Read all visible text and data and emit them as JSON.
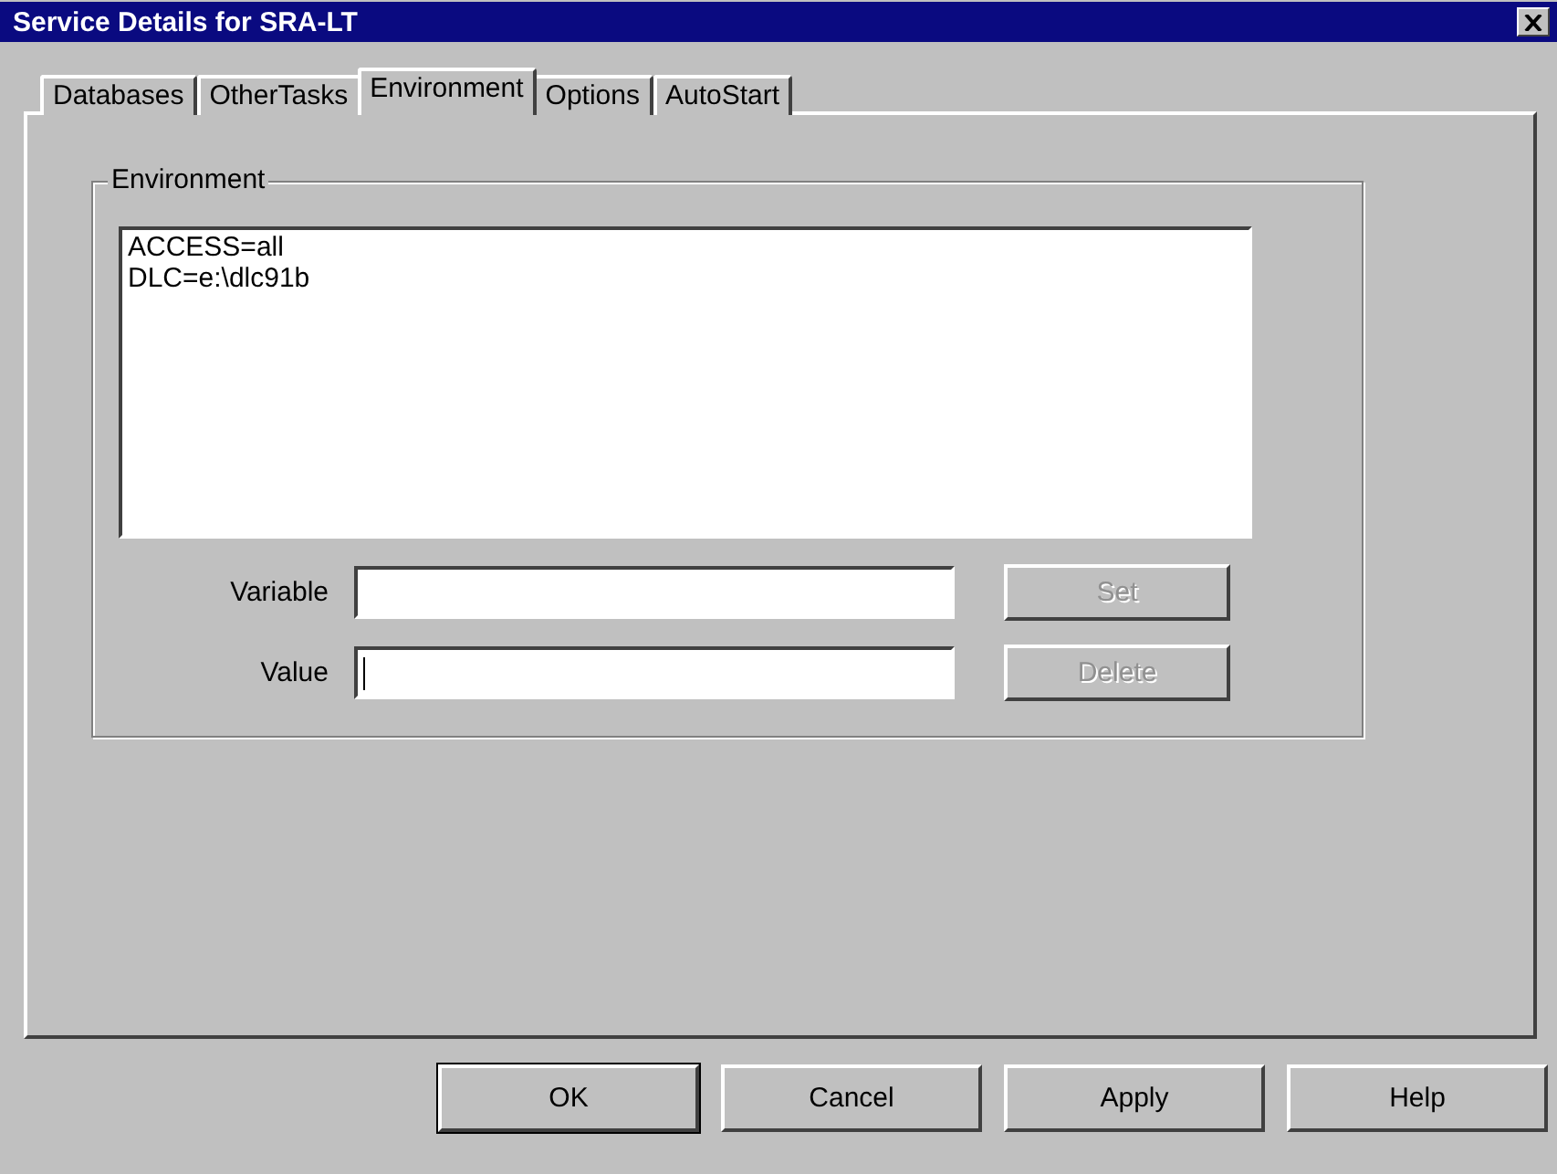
{
  "window": {
    "title": "Service Details for SRA-LT"
  },
  "tabs": [
    {
      "label": "Databases",
      "selected": false
    },
    {
      "label": "OtherTasks",
      "selected": false
    },
    {
      "label": "Environment",
      "selected": true
    },
    {
      "label": "Options",
      "selected": false
    },
    {
      "label": "AutoStart",
      "selected": false
    }
  ],
  "group": {
    "title": "Environment",
    "list_items": [
      "ACCESS=all",
      "DLC=e:\\dlc91b"
    ],
    "fields": [
      {
        "label": "Variable",
        "focused": false,
        "button": {
          "label": "Set",
          "disabled": true
        }
      },
      {
        "label": "Value",
        "focused": true,
        "button": {
          "label": "Delete",
          "disabled": true
        }
      }
    ]
  },
  "buttons": [
    {
      "label": "OK",
      "default": true
    },
    {
      "label": "Cancel",
      "default": false
    },
    {
      "label": "Apply",
      "default": false
    },
    {
      "label": "Help",
      "default": false
    }
  ]
}
